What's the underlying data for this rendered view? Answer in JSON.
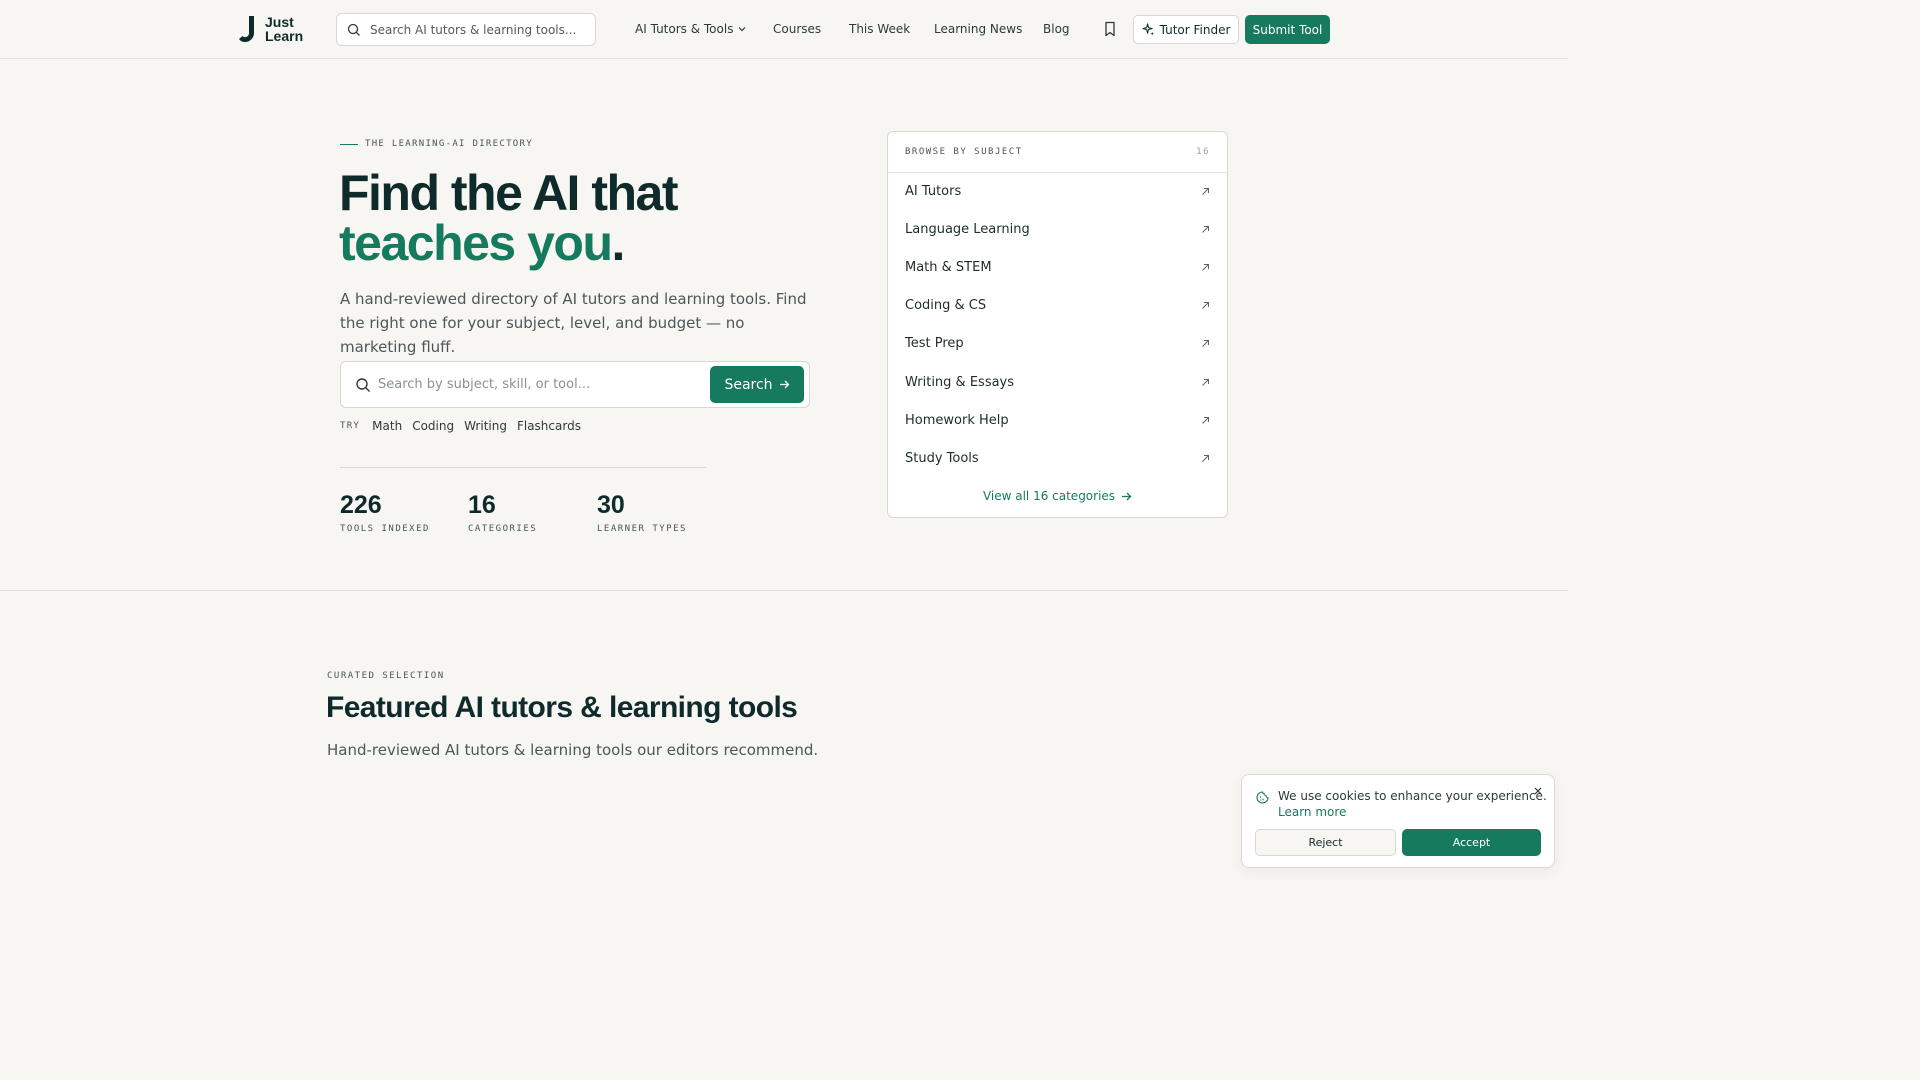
{
  "header": {
    "logo": {
      "line1": "Just",
      "line2": "Learn"
    },
    "search_placeholder": "Search AI tutors & learning tools...",
    "nav": [
      "AI Tutors & Tools",
      "Courses",
      "This Week",
      "Learning News",
      "Blog"
    ],
    "tutor_finder": "Tutor Finder",
    "submit_tool": "Submit Tool"
  },
  "hero": {
    "eyebrow": "THE LEARNING-AI DIRECTORY",
    "title_line1": "Find the AI that",
    "title_accent": "teaches you",
    "title_end": ".",
    "subtitle": "A hand-reviewed directory of AI tutors and learning tools. Find the right one for your subject, level, and budget — no marketing fluff.",
    "search_placeholder": "Search by subject, skill, or tool...",
    "search_button": "Search",
    "try_label": "TRY",
    "try_chips": [
      "Math",
      "Coding",
      "Writing",
      "Flashcards"
    ],
    "stats": [
      {
        "value": "226",
        "label": "TOOLS INDEXED"
      },
      {
        "value": "16",
        "label": "CATEGORIES"
      },
      {
        "value": "30",
        "label": "LEARNER TYPES"
      }
    ]
  },
  "browse": {
    "heading": "BROWSE BY SUBJECT",
    "count": "16",
    "categories": [
      "AI Tutors",
      "Language Learning",
      "Math & STEM",
      "Coding & CS",
      "Test Prep",
      "Writing & Essays",
      "Homework Help",
      "Study Tools"
    ],
    "view_all": "View all 16 categories"
  },
  "featured": {
    "eyebrow": "CURATED SELECTION",
    "title": "Featured AI tutors & learning tools",
    "subtitle": "Hand-reviewed AI tutors & learning tools our editors recommend."
  },
  "cookie": {
    "message": "We use cookies to enhance your experience.",
    "learn_more": "Learn more",
    "reject": "Reject",
    "accept": "Accept"
  },
  "colors": {
    "accent": "#157a5e",
    "ink": "#0f2a2a",
    "background": "#f7f6f2"
  }
}
